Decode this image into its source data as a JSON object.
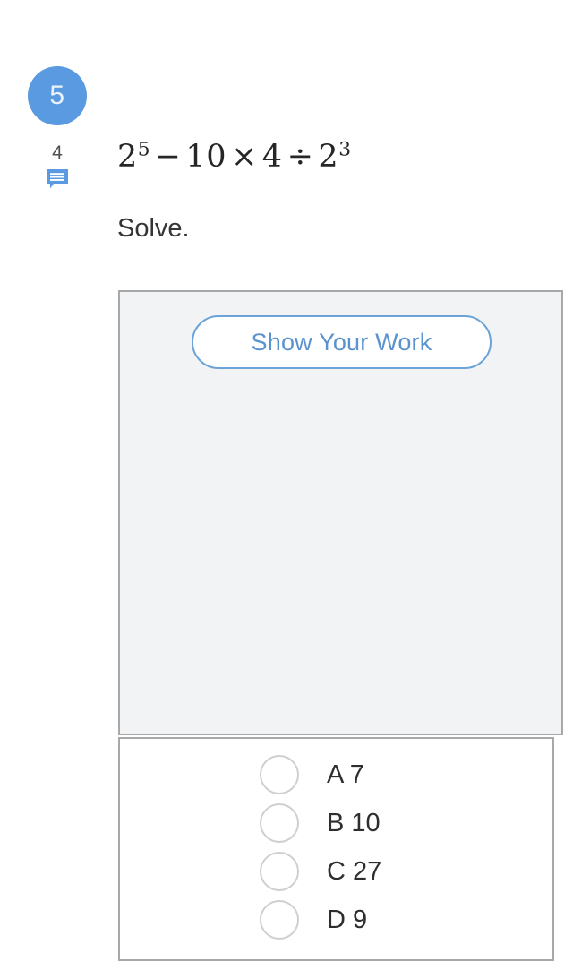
{
  "question": {
    "number": "5",
    "comment_count": "4",
    "comment_icon": "comment-bubble-icon",
    "expression": {
      "base1": "2",
      "exp1": "5",
      "op1": "−",
      "num2": "10",
      "op2": "×",
      "num3": "4",
      "op3": "÷",
      "base2": "2",
      "exp2": "3",
      "plain": "2^5 − 10 × 4 ÷ 2^3"
    },
    "prompt": "Solve."
  },
  "work_area": {
    "show_work_label": "Show Your Work",
    "canvas_content": ""
  },
  "answers": {
    "choices": [
      {
        "letter": "A",
        "value": "7",
        "label": "A 7",
        "selected": false
      },
      {
        "letter": "B",
        "value": "10",
        "label": "B 10",
        "selected": false
      },
      {
        "letter": "C",
        "value": "27",
        "label": "C 27",
        "selected": false
      },
      {
        "letter": "D",
        "value": "9",
        "label": "D 9",
        "selected": false
      }
    ]
  },
  "colors": {
    "badge_blue": "#5a9ae0",
    "accent_blue": "#5a93cf",
    "button_border": "#6ba3d8",
    "panel_border": "#a8a8a8",
    "canvas_fill": "#f2f3f4",
    "text_dark": "#2e2e2e",
    "radio_border": "#cfcfcf"
  }
}
